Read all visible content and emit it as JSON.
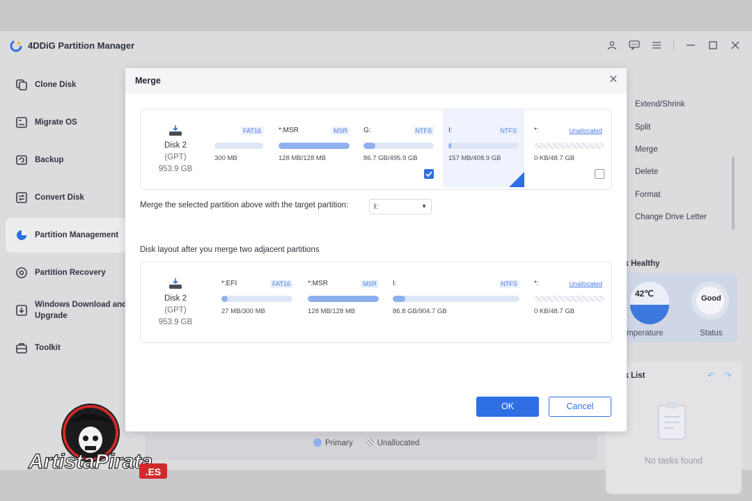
{
  "app": {
    "title": "4DDiG Partition Manager"
  },
  "sidebar": {
    "items": [
      {
        "label": "Clone Disk",
        "icon": "clone-disk-icon"
      },
      {
        "label": "Migrate OS",
        "icon": "migrate-os-icon"
      },
      {
        "label": "Backup",
        "icon": "backup-icon"
      },
      {
        "label": "Convert Disk",
        "icon": "convert-disk-icon"
      },
      {
        "label": "Partition Management",
        "icon": "pie-chart-icon",
        "active": true
      },
      {
        "label": "Partition Recovery",
        "icon": "partition-recovery-icon"
      },
      {
        "label": "Windows Download and Upgrade",
        "icon": "windows-download-icon"
      },
      {
        "label": "Toolkit",
        "icon": "toolkit-icon"
      }
    ]
  },
  "right_panel": {
    "operations": [
      "Extend/Shrink",
      "Split",
      "Merge",
      "Delete",
      "Format",
      "Change Drive Letter"
    ],
    "health_title": "sk Healthy",
    "temperature_value": "42℃",
    "temperature_label": "mperature",
    "status_value": "Good",
    "status_label": "Status",
    "task_list_title": "sk List",
    "no_tasks": "No tasks found"
  },
  "legend": {
    "primary": "Primary",
    "unallocated": "Unallocated"
  },
  "modal": {
    "title": "Merge",
    "merge_label": "Merge the selected partition above with the target partition:",
    "target_value": "I:",
    "layout_label": "Disk layout after you merge two adjacent partitions",
    "ok_label": "OK",
    "cancel_label": "Cancel",
    "before": {
      "disk_name": "Disk 2",
      "disk_type": "(GPT)",
      "disk_size": "953.9 GB",
      "partitions": [
        {
          "name": "",
          "fs": "FAT16",
          "size": "300 MB",
          "usage": 0.0,
          "unallocated": false
        },
        {
          "name": "*:MSR",
          "fs": "MSR",
          "size": "128 MB/128 MB",
          "usage": 1.0,
          "unallocated": false
        },
        {
          "name": "G:",
          "fs": "NTFS",
          "size": "86.7 GB/495.9 GB",
          "usage": 0.17,
          "unallocated": false,
          "checked": true
        },
        {
          "name": "I:",
          "fs": "NTFS",
          "size": "157 MB/408.9 GB",
          "usage": 0.02,
          "unallocated": false,
          "selected": true
        },
        {
          "name": "*:",
          "fs": "Unallocated",
          "size": "0 KB/48.7 GB",
          "usage": 0,
          "unallocated": true,
          "checked": false
        }
      ]
    },
    "after": {
      "disk_name": "Disk 2",
      "disk_type": "(GPT)",
      "disk_size": "953.9 GB",
      "partitions": [
        {
          "name": "*:EFI",
          "fs": "FAT16",
          "size": "27 MB/300 MB",
          "usage": 0.09,
          "unallocated": false
        },
        {
          "name": "*:MSR",
          "fs": "MSR",
          "size": "128 MB/128 MB",
          "usage": 1.0,
          "unallocated": false
        },
        {
          "name": "I:",
          "fs": "NTFS",
          "size": "86.8 GB/904.7 GB",
          "usage": 0.1,
          "unallocated": false
        },
        {
          "name": "*:",
          "fs": "Unallocated",
          "size": "0 KB/48.7 GB",
          "usage": 0,
          "unallocated": true
        }
      ]
    }
  },
  "watermark": {
    "text": "ArtistaPirata",
    "suffix": ".ES"
  },
  "colors": {
    "accent": "#2f6fe4",
    "bar_fill": "#8fb0ee",
    "bar_track": "#dfe6f5"
  }
}
